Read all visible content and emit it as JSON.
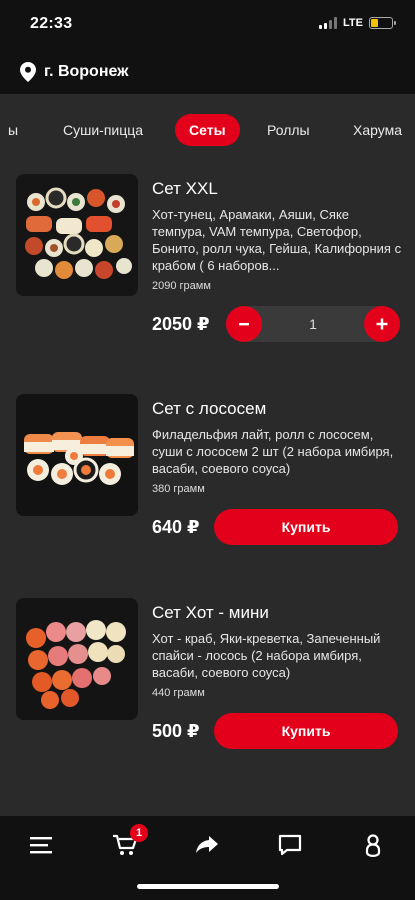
{
  "status_bar": {
    "time": "22:33",
    "network": "LTE",
    "battery_level": 0.35
  },
  "header": {
    "city": "г. Воронеж",
    "icon": "location-pin-icon"
  },
  "tabs": [
    {
      "label": "ы",
      "active": false
    },
    {
      "label": "Суши-пицца",
      "active": false
    },
    {
      "label": "Сеты",
      "active": true
    },
    {
      "label": "Роллы",
      "active": false
    },
    {
      "label": "Харума",
      "active": false
    }
  ],
  "products": [
    {
      "title": "Сет XXL",
      "description": "Хот-тунец, Арамаки, Аяши, Сяке темпура, VAM темпура, Светофор, Бонито, ролл чука, Гейша, Калифорния с крабом ( 6 наборов...",
      "weight": "2090 грамм",
      "price": "2050 ₽",
      "quantity": "1"
    },
    {
      "title": "Сет с лососем",
      "description": "Филадельфия лайт, ролл с лососем, суши с лососем 2 шт (2 набора имбиря, васаби, соевого соуса)",
      "weight": "380 грамм",
      "price": "640 ₽",
      "buy_label": "Купить"
    },
    {
      "title": "Сет Хот - мини",
      "description": "Хот - краб, Яки-креветка, Запеченный спайси - лосось (2 набора имбиря, васаби, соевого соуса)",
      "weight": "440 грамм",
      "price": "500 ₽",
      "buy_label": "Купить"
    }
  ],
  "bottom_nav": {
    "items": [
      "menu-icon",
      "cart-icon",
      "share-icon",
      "chat-icon",
      "profile-icon"
    ],
    "cart_badge": "1"
  },
  "colors": {
    "accent": "#e3001b",
    "background": "#2a2a2a",
    "bar": "#111111"
  }
}
